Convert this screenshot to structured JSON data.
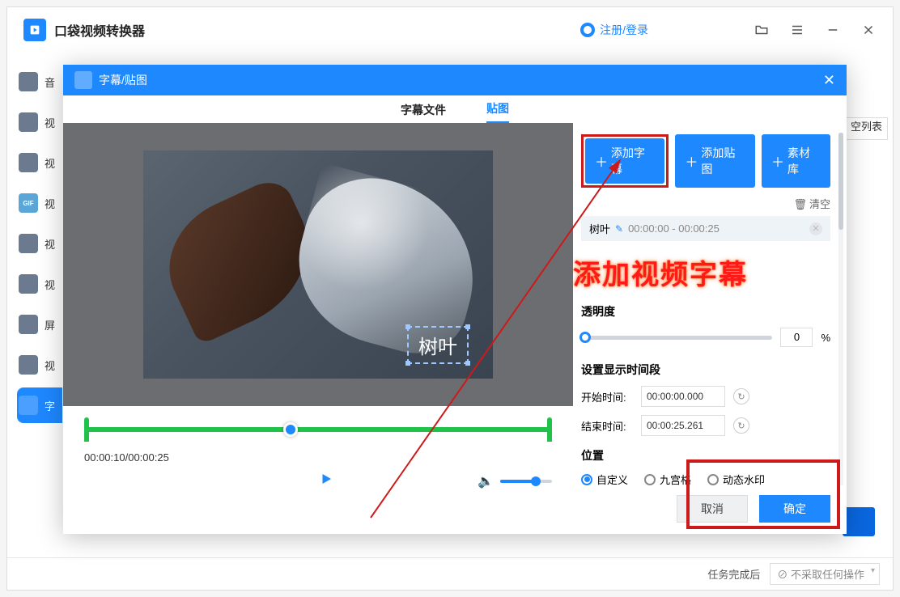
{
  "app": {
    "title": "口袋视频转换器"
  },
  "header": {
    "login": "注册/登录",
    "clear_list": "空列表"
  },
  "sidebar": {
    "items": [
      {
        "label": "音"
      },
      {
        "label": "视"
      },
      {
        "label": "视"
      },
      {
        "label": "视"
      },
      {
        "label": "视"
      },
      {
        "label": "视"
      },
      {
        "label": "屏"
      },
      {
        "label": "视"
      },
      {
        "label": "字"
      }
    ]
  },
  "bottom": {
    "task_after": "任务完成后",
    "no_action": "不采取任何操作"
  },
  "modal": {
    "title": "字幕/贴图",
    "tabs": {
      "subtitle_file": "字幕文件",
      "sticker": "贴图"
    },
    "preview": {
      "subtitle_text": "树叶",
      "time": "00:00:10/00:00:25"
    },
    "actions": {
      "add_subtitle": "添加字幕",
      "add_sticker": "添加贴图",
      "material_lib": "素材库",
      "clear": "清空"
    },
    "subtitle_item": {
      "name": "树叶",
      "start": "00:00:00",
      "end": "00:00:25"
    },
    "annotation": "添加视频字幕",
    "opacity": {
      "label": "透明度",
      "value": "0",
      "unit": "%"
    },
    "time_range": {
      "label": "设置显示时间段",
      "start_label": "开始时间:",
      "start_value": "00:00:00.000",
      "end_label": "结束时间:",
      "end_value": "00:00:25.261"
    },
    "position": {
      "label": "位置",
      "custom": "自定义",
      "grid": "九宫格",
      "dynamic": "动态水印"
    },
    "footer": {
      "cancel": "取消",
      "ok": "确定"
    }
  }
}
